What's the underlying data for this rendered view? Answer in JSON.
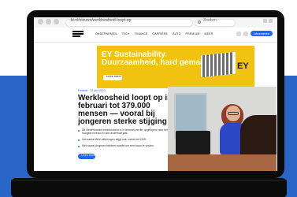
{
  "browser": {
    "url": "bi.nl/nieuws/werkloosheid-loopt-op",
    "search_placeholder": "Zoeken"
  },
  "site": {
    "nav": [
      "ONDERNEMEN",
      "TECH",
      "FINANCE",
      "CARRIÈRE",
      "AUTO",
      "PREMIUM",
      "MEER"
    ],
    "subscribe_label": "Abonneren"
  },
  "ad": {
    "line1": "EY Sustainability.",
    "line2": "Duurzaamheid, hard gemaakt.",
    "button_label": "Lees meer",
    "logo_text": "EY"
  },
  "article": {
    "breadcrumb": "Finance · 12 juni 2023",
    "headline": "Werkloosheid loopt op in februari tot 379.000 mensen — vooral bij jongeren sterke stijging",
    "bullets": [
      "De Nederlandse werkloosheid is in februari verder opgelopen naar het hoogste niveau in ruim anderhalf jaar.",
      "Het aantal WW-uitkeringen stijgt ook, meldt het CBS.",
      "Met name jongeren hebben moeite om een baan te vinden."
    ],
    "read_label": "Lees meer"
  },
  "colors": {
    "accent_blue": "#1e66ff",
    "ad_yellow": "#f2c211",
    "page_blue": "#2a66c8"
  }
}
